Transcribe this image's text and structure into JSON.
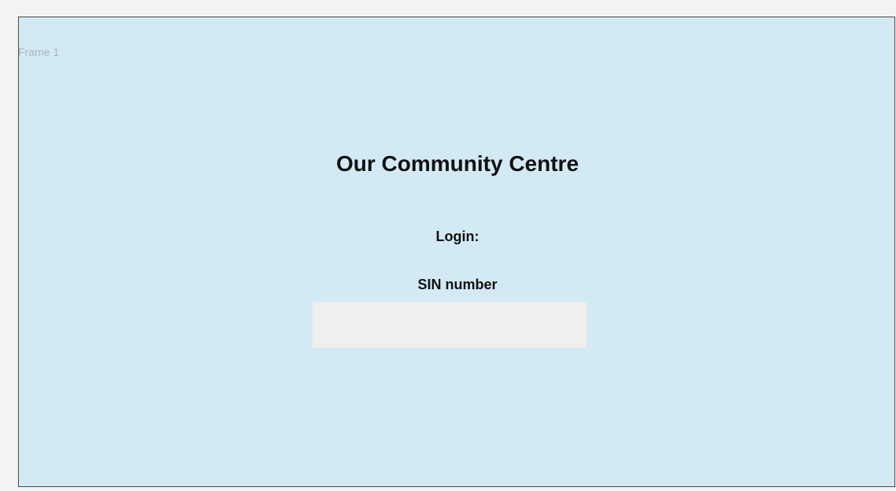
{
  "frame": {
    "label": "Frame 1"
  },
  "page": {
    "title": "Our Community Centre",
    "login_label": "Login:",
    "sin_label": "SIN number",
    "sin_value": ""
  },
  "colors": {
    "frame_background": "#d3eaf4",
    "input_background": "#efefef",
    "canvas_background": "#f3f3f3"
  }
}
